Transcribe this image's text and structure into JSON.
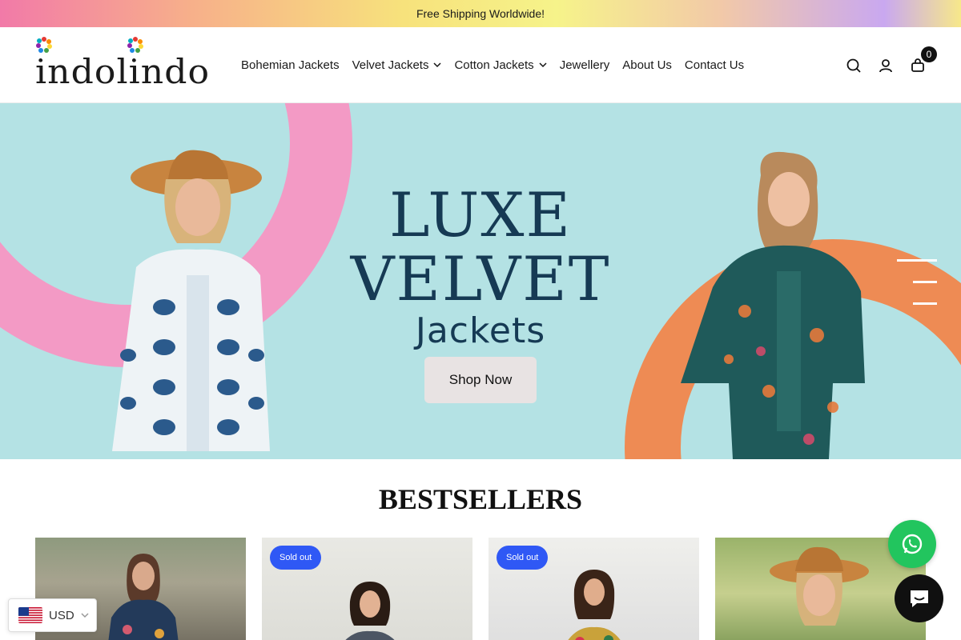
{
  "announcement": {
    "text": "Free Shipping Worldwide!"
  },
  "brand": {
    "logo_text": "indolindo"
  },
  "nav": {
    "items": [
      {
        "label": "Bohemian Jackets",
        "dropdown": false
      },
      {
        "label": "Velvet Jackets",
        "dropdown": true
      },
      {
        "label": "Cotton Jackets",
        "dropdown": true
      },
      {
        "label": "Jewellery",
        "dropdown": false
      },
      {
        "label": "About Us",
        "dropdown": false
      },
      {
        "label": "Contact Us",
        "dropdown": false
      }
    ]
  },
  "header_icons": {
    "search": "search-icon",
    "account": "user-icon",
    "cart": "bag-icon",
    "cart_count": "0"
  },
  "hero": {
    "title_line1": "LUXE",
    "title_line2": "VELVET",
    "title_line3": "Jackets",
    "cta_label": "Shop Now",
    "colors": {
      "background": "#b4e2e4",
      "pink_ring": "#f39ac5",
      "orange_ring": "#ee8b54",
      "title": "#163a54"
    }
  },
  "bestsellers": {
    "title": "BESTSELLERS",
    "products": [
      {
        "badge": ""
      },
      {
        "badge": "Sold out"
      },
      {
        "badge": "Sold out"
      },
      {
        "badge": ""
      }
    ]
  },
  "currency": {
    "code": "USD"
  },
  "widgets": {
    "whatsapp": "whatsapp-icon",
    "chat": "chat-icon"
  }
}
